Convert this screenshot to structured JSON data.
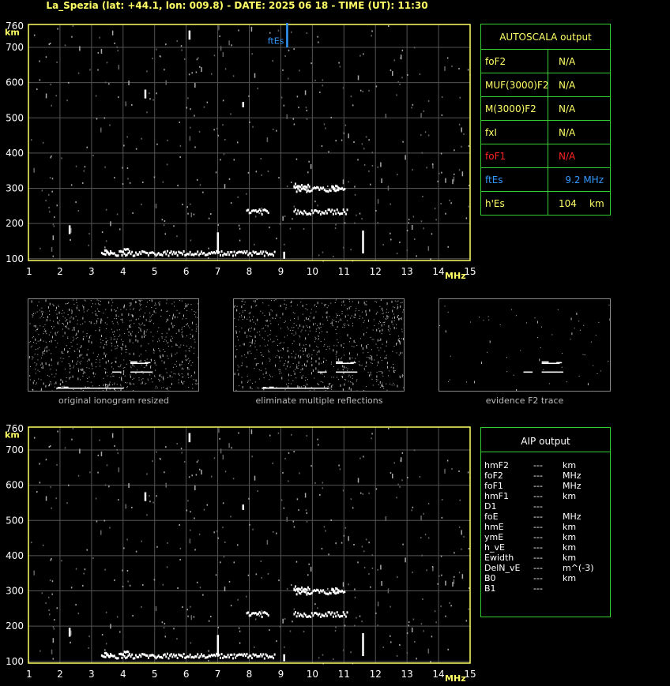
{
  "title": "La_Spezia (lat: +44.1, lon: 009.8) - DATE: 2025 06 18 - TIME (UT): 11:30",
  "colors": {
    "grid": "#555555",
    "axis": "#ffff66",
    "panel_border": "#33cc33",
    "ftEs": "#3399ff",
    "foF1_red": "#ff2222",
    "value_yellow": "#ffff66"
  },
  "chart_data": [
    {
      "type": "scatter",
      "id": "main-ionogram",
      "xlabel": "MHz",
      "ylabel": "km",
      "xlim": [
        1,
        15
      ],
      "ylim": [
        95,
        765
      ],
      "xticks": [
        1,
        2,
        3,
        4,
        5,
        6,
        7,
        8,
        9,
        10,
        11,
        12,
        13,
        14,
        15
      ],
      "yticks": [
        100,
        200,
        300,
        400,
        500,
        600,
        700,
        760
      ],
      "grid": true,
      "marker_label": "ftEs",
      "marker_freq": 9.2
    },
    {
      "type": "scatter",
      "id": "aip-ionogram",
      "xlabel": "MHz",
      "ylabel": "km",
      "xlim": [
        1,
        15
      ],
      "ylim": [
        95,
        765
      ],
      "xticks": [
        1,
        2,
        3,
        4,
        5,
        6,
        7,
        8,
        9,
        10,
        11,
        12,
        13,
        14,
        15
      ],
      "yticks": [
        100,
        200,
        300,
        400,
        500,
        600,
        700,
        760
      ],
      "grid": true
    }
  ],
  "echo_traces": [
    {
      "f0": 3.3,
      "f1": 8.8,
      "h": 118
    },
    {
      "f0": 3.4,
      "f1": 3.6,
      "h": 123
    },
    {
      "f0": 3.9,
      "f1": 4.2,
      "h": 125
    },
    {
      "f0": 7.9,
      "f1": 8.6,
      "h": 236
    },
    {
      "f0": 9.4,
      "f1": 11.1,
      "h": 236
    },
    {
      "f0": 9.4,
      "f1": 10.8,
      "h": 300
    },
    {
      "f0": 9.4,
      "f1": 9.9,
      "h": 310
    },
    {
      "f0": 10.6,
      "f1": 11.0,
      "h": 305
    }
  ],
  "echo_spikes": [
    {
      "f": 2.3,
      "h0": 170,
      "h1": 195
    },
    {
      "f": 4.7,
      "h0": 555,
      "h1": 580
    },
    {
      "f": 6.1,
      "h0": 722,
      "h1": 748
    },
    {
      "f": 7.0,
      "h0": 115,
      "h1": 175
    },
    {
      "f": 7.8,
      "h0": 530,
      "h1": 545
    },
    {
      "f": 9.1,
      "h0": 100,
      "h1": 120
    },
    {
      "f": 11.6,
      "h0": 115,
      "h1": 180
    }
  ],
  "autoscala": {
    "header": "AUTOSCALA output",
    "rows": [
      {
        "label": "foF2",
        "value": "N/A",
        "unit": ""
      },
      {
        "label": "MUF(3000)F2",
        "value": "N/A",
        "unit": ""
      },
      {
        "label": "M(3000)F2",
        "value": "N/A",
        "unit": ""
      },
      {
        "label": "fxI",
        "value": "N/A",
        "unit": ""
      },
      {
        "label": "foF1",
        "value": "N/A",
        "unit": ""
      },
      {
        "label": "ftEs",
        "value": "9.2 MHz",
        "unit": ""
      },
      {
        "label": "h'Es",
        "value": "104",
        "unit": "km"
      }
    ]
  },
  "thumbnails": [
    {
      "caption": "original ionogram resized"
    },
    {
      "caption": "eliminate multiple reflections"
    },
    {
      "caption": "evidence F2 trace"
    }
  ],
  "aip": {
    "header": "AIP output",
    "rows": [
      {
        "label": "hmF2",
        "value": "---",
        "unit": "km"
      },
      {
        "label": "foF2",
        "value": "---",
        "unit": "MHz"
      },
      {
        "label": "foF1",
        "value": "---",
        "unit": "MHz"
      },
      {
        "label": "hmF1",
        "value": "---",
        "unit": "km"
      },
      {
        "label": "D1",
        "value": "---",
        "unit": ""
      },
      {
        "label": "foE",
        "value": "---",
        "unit": "MHz"
      },
      {
        "label": "hmE",
        "value": "---",
        "unit": "km"
      },
      {
        "label": "ymE",
        "value": "---",
        "unit": "km"
      },
      {
        "label": "h_vE",
        "value": "---",
        "unit": "km"
      },
      {
        "label": "Ewidth",
        "value": "---",
        "unit": "km"
      },
      {
        "label": "DelN_vE",
        "value": "---",
        "unit": "m^(-3)"
      },
      {
        "label": "B0",
        "value": "---",
        "unit": "km"
      },
      {
        "label": "B1",
        "value": "---",
        "unit": ""
      }
    ]
  }
}
